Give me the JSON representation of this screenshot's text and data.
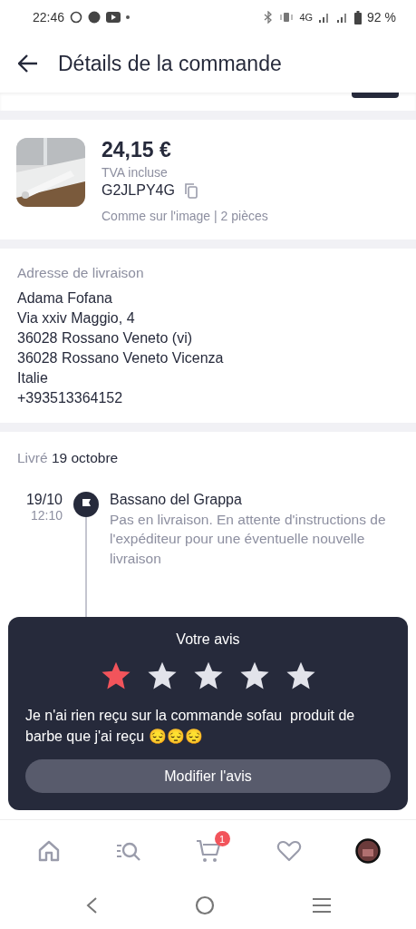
{
  "status_bar": {
    "time": "22:46",
    "network": "4G",
    "battery": "92 %"
  },
  "header": {
    "title": "Détails de la commande"
  },
  "product": {
    "price": "24,15 €",
    "tax_note": "TVA incluse",
    "code": "G2JLPY4G",
    "variant": "Comme sur l'image | 2 pièces"
  },
  "address": {
    "heading": "Adresse de livraison",
    "lines": [
      "Adama Fofana",
      "Via xxiv Maggio, 4",
      "36028 Rossano Veneto (vi)",
      "36028 Rossano Veneto Vicenza",
      "Italie",
      "+393513364152"
    ]
  },
  "tracking": {
    "status": "Livré",
    "date": "19 octobre",
    "events": [
      {
        "date": "19/10",
        "time": "12:10",
        "place": "Bassano del Grappa",
        "detail": "Pas en livraison. En attente d'instructions de l'expéditeur pour une éventuelle nouvelle livraison"
      }
    ]
  },
  "review": {
    "title": "Votre avis",
    "stars": 1,
    "comment": "Je n'ai rien reçu sur la commande sofau  produit de barbe que j'ai reçu 😔😔😔",
    "button": "Modifier l'avis"
  },
  "bottom_nav": [
    {
      "kind": "home"
    },
    {
      "kind": "search"
    },
    {
      "kind": "cart",
      "badge": "1"
    },
    {
      "kind": "heart"
    },
    {
      "kind": "avatar"
    }
  ]
}
